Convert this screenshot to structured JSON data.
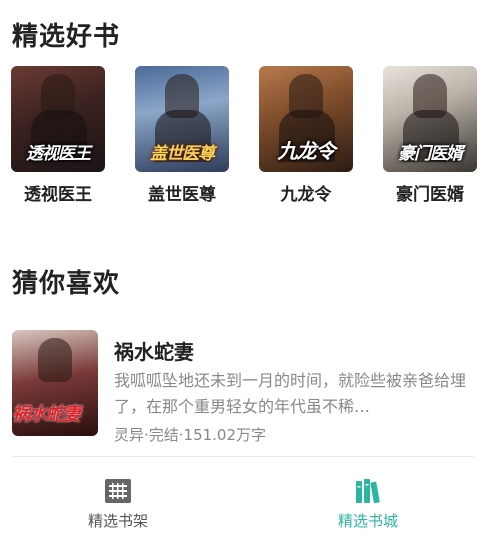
{
  "featured": {
    "title": "精选好书",
    "books": [
      {
        "name": "透视医王",
        "cover_text": "透视医王"
      },
      {
        "name": "盖世医尊",
        "cover_text": "盖世医尊"
      },
      {
        "name": "九龙令",
        "cover_text": "九龙令"
      },
      {
        "name": "豪门医婿",
        "cover_text": "豪门医婿"
      }
    ]
  },
  "guess": {
    "title": "猜你喜欢",
    "items": [
      {
        "cover_text": "祸水蛇妻",
        "title": "祸水蛇妻",
        "desc": "我呱呱坠地还未到一月的时间，就险些被亲爸给埋了，在那个重男轻女的年代虽不稀…",
        "meta": "灵异·完结·151.02万字"
      }
    ]
  },
  "tabbar": {
    "shelf_label": "精选书架",
    "store_label": "精选书城",
    "active_color": "#2bb5a3",
    "inactive_color": "#555555",
    "shelf_icon": "bookshelf-icon",
    "store_icon": "books-icon"
  }
}
